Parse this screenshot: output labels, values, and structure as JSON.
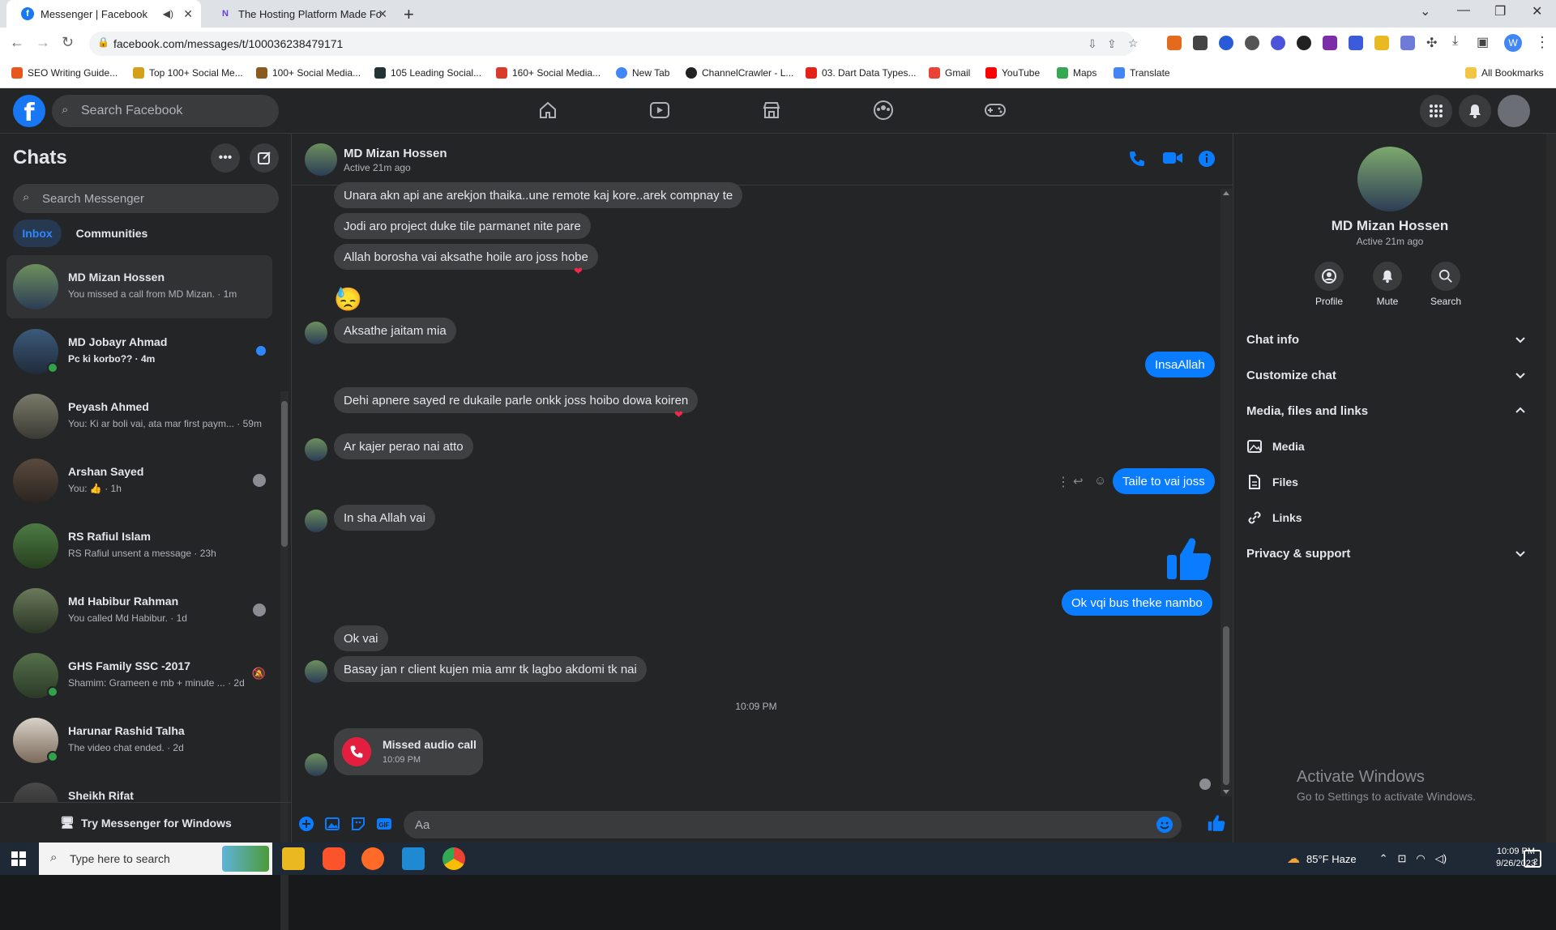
{
  "browser": {
    "tabs": [
      {
        "title": "Messenger | Facebook",
        "active": true
      },
      {
        "title": "The Hosting Platform Made For",
        "active": false
      }
    ],
    "url": "facebook.com/messages/t/100036238479171",
    "bookmarks": [
      "SEO Writing Guide...",
      "Top 100+ Social Me...",
      "100+ Social Media...",
      "105 Leading Social...",
      "160+ Social Media...",
      "New Tab",
      "ChannelCrawler - L...",
      "03. Dart Data Types...",
      "Gmail",
      "YouTube",
      "Maps",
      "Translate"
    ],
    "all_bookmarks": "All Bookmarks",
    "profile_initial": "W"
  },
  "fb": {
    "search_placeholder": "Search Facebook"
  },
  "sidebar": {
    "title": "Chats",
    "search_placeholder": "Search Messenger",
    "tabs": [
      "Inbox",
      "Communities"
    ],
    "chats": [
      {
        "name": "MD Mizan Hossen",
        "preview": "You missed a call from MD Mizan. · 1m",
        "online": false
      },
      {
        "name": "MD Jobayr Ahmad",
        "preview": "Pc ki korbo?? · 4m",
        "online": true,
        "unread": true
      },
      {
        "name": "Peyash Ahmed",
        "preview": "You: Ki ar boli vai, ata mar first paym... · 59m",
        "online": false
      },
      {
        "name": "Arshan Sayed",
        "preview": "You: 👍 · 1h",
        "online": false
      },
      {
        "name": "RS Rafiul Islam",
        "preview": "RS Rafiul unsent a message · 23h",
        "online": false
      },
      {
        "name": "Md Habibur Rahman",
        "preview": "You called Md Habibur. · 1d",
        "online": false
      },
      {
        "name": "GHS Family SSC -2017",
        "preview": "Shamim: Grameen e mb + minute ... · 2d",
        "online": true
      },
      {
        "name": "Harunar Rashid Talha",
        "preview": "The video chat ended. · 2d",
        "online": true
      },
      {
        "name": "Sheikh Rifat",
        "preview": "",
        "online": false
      }
    ],
    "try_messenger": "Try Messenger for Windows"
  },
  "conversation": {
    "name": "MD Mizan Hossen",
    "status": "Active 21m ago",
    "messages": [
      {
        "text": "Unara akn api ane arekjon thaika..une remote kaj kore..arek compnay te",
        "dir": "in"
      },
      {
        "text": "Jodi aro project duke tile parmanet nite pare",
        "dir": "in"
      },
      {
        "text": "Allah borosha vai aksathe hoile aro joss hobe",
        "dir": "in",
        "reaction": "❤"
      },
      {
        "text": "😓",
        "dir": "in",
        "emoji": true
      },
      {
        "text": "Aksathe jaitam mia",
        "dir": "in"
      },
      {
        "text": "InsaAllah",
        "dir": "out"
      },
      {
        "text": "Dehi apnere sayed re dukaile parle onkk joss hoibo dowa koiren",
        "dir": "in",
        "reaction": "❤"
      },
      {
        "text": "Ar kajer perao nai atto",
        "dir": "in"
      },
      {
        "text": "Taile to vai joss",
        "dir": "out"
      },
      {
        "text": "In sha Allah vai",
        "dir": "in"
      },
      {
        "text": "👍",
        "dir": "out",
        "emoji": true
      },
      {
        "text": "Ok vqi bus theke nambo",
        "dir": "out"
      },
      {
        "text": "Ok vai",
        "dir": "in"
      },
      {
        "text": "Basay jan r client kujen mia amr tk lagbo akdomi tk nai",
        "dir": "in"
      }
    ],
    "timestamp": "10:09 PM",
    "missed_call": {
      "title": "Missed audio call",
      "time": "10:09 PM"
    },
    "composer_placeholder": "Aa"
  },
  "info_panel": {
    "name": "MD Mizan Hossen",
    "status": "Active 21m ago",
    "actions": [
      "Profile",
      "Mute",
      "Search"
    ],
    "sections": [
      "Chat info",
      "Customize chat",
      "Media, files and links"
    ],
    "media_items": [
      "Media",
      "Files",
      "Links"
    ],
    "privacy": "Privacy & support"
  },
  "watermark": {
    "line1": "Activate Windows",
    "line2": "Go to Settings to activate Windows."
  },
  "taskbar": {
    "search_placeholder": "Type here to search",
    "weather": "85°F  Haze",
    "time": "10:09 PM",
    "date": "9/26/2023",
    "notification_count": "2"
  },
  "colors": {
    "accent": "#0a7cff",
    "fb_blue": "#1877f2",
    "bg": "#242526",
    "bubble_in": "#3e4042"
  }
}
